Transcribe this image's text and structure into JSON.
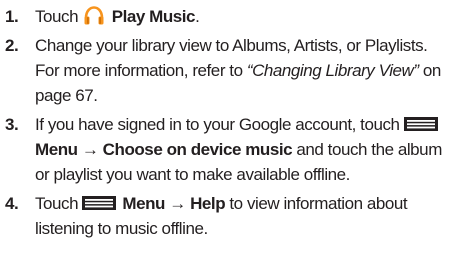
{
  "steps": [
    {
      "num": "1.",
      "pre": "Touch",
      "icon": "play-music-headphones-icon",
      "bold": "Play Music",
      "post": "."
    },
    {
      "num": "2.",
      "pre": "Change your library view to Albums, Artists, or Playlists. For more information, refer to ",
      "italic": "“Changing Library View”",
      "post": " on page 67."
    },
    {
      "num": "3.",
      "pre": "If you have signed in to your Google account, touch",
      "icon": "menu-icon",
      "bold": "Menu → Choose on device music",
      "post": " and touch the album or playlist you want to make available offline."
    },
    {
      "num": "4.",
      "pre": "Touch",
      "icon": "menu-icon",
      "bold": "Menu → Help",
      "post": " to view information about listening to music offline."
    }
  ],
  "colors": {
    "text": "#231f20",
    "headphones_orange": "#f7941d",
    "menu_icon": "#231f20"
  }
}
